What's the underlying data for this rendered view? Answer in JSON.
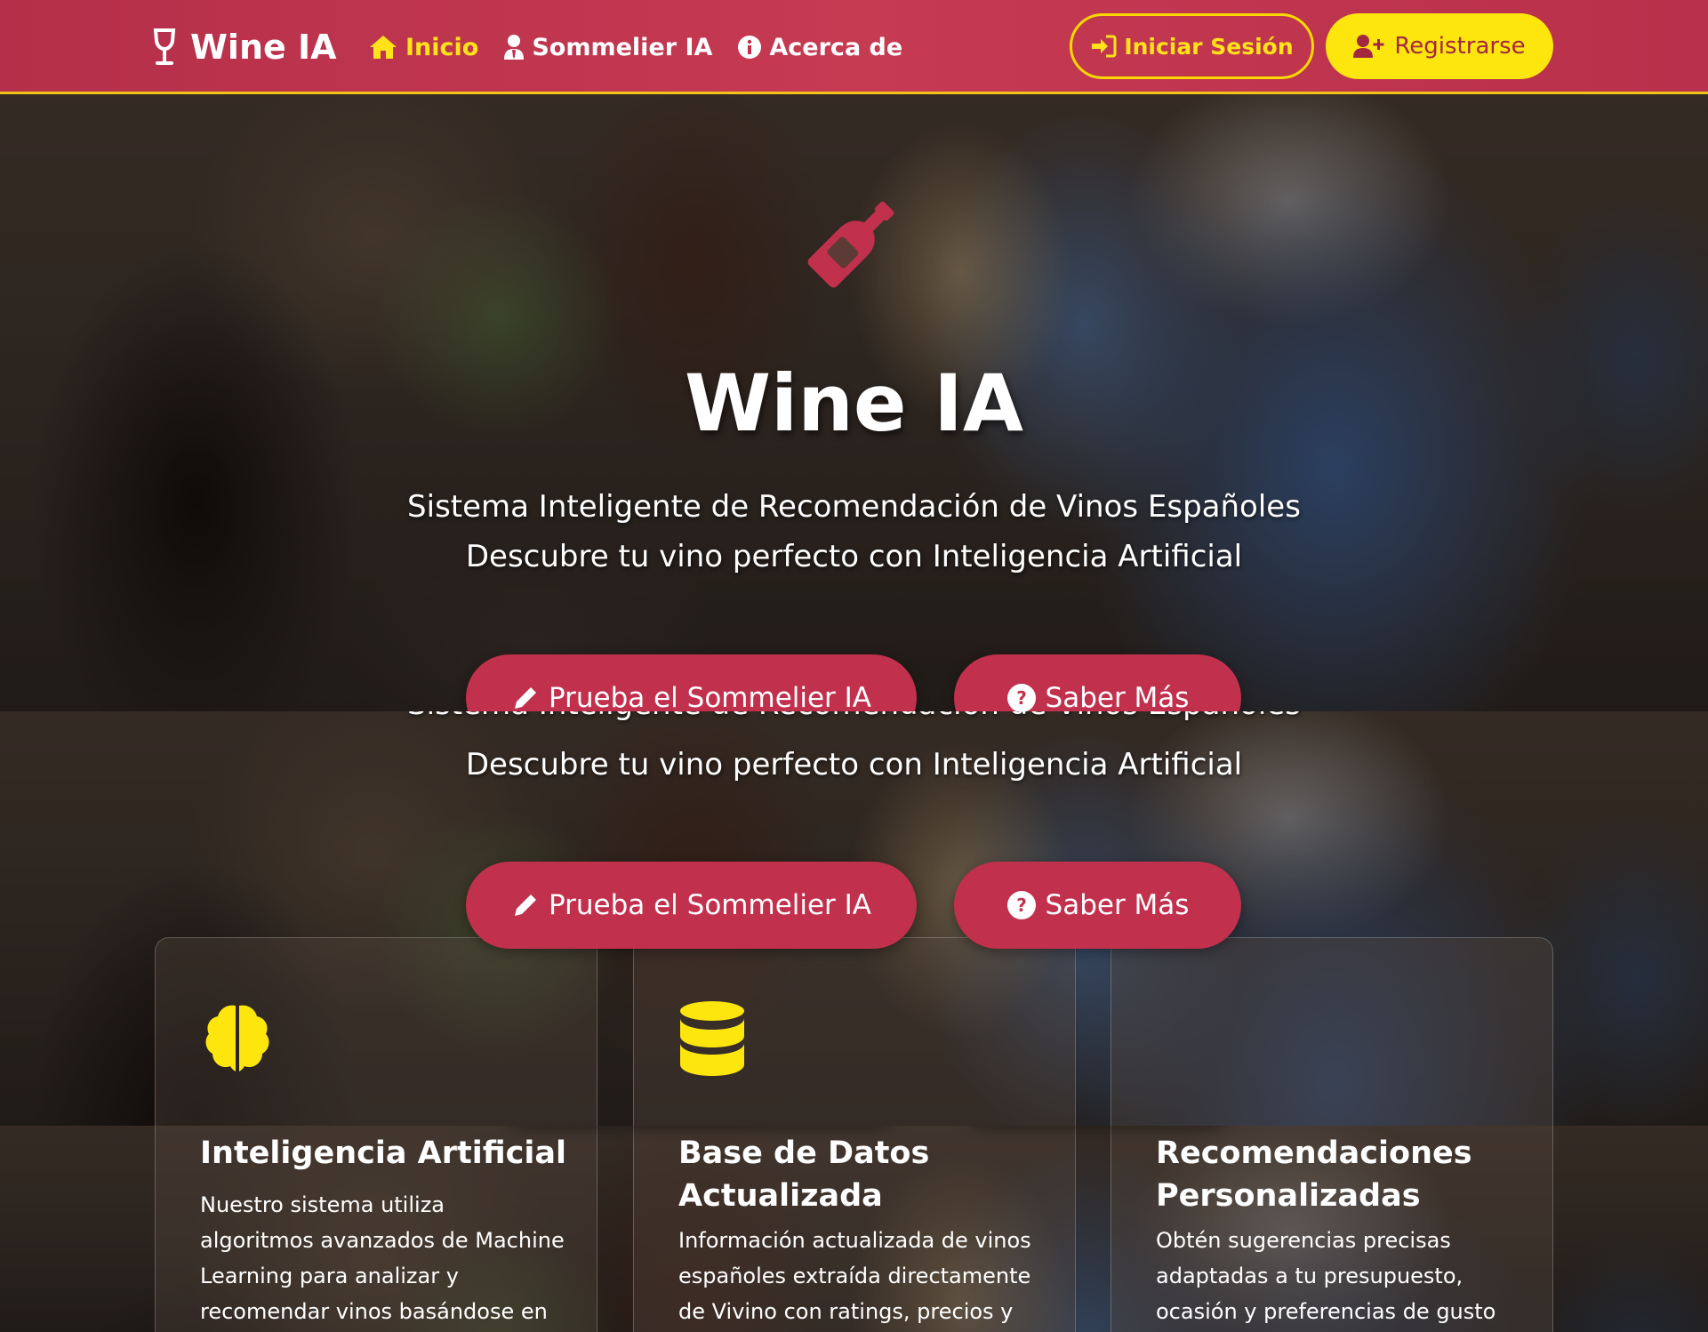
{
  "navbar": {
    "brand": "Wine IA",
    "links": [
      {
        "label": "Inicio",
        "icon": "home-icon",
        "active": true
      },
      {
        "label": "Sommelier IA",
        "icon": "user-tie-icon",
        "active": false
      },
      {
        "label": "Acerca de",
        "icon": "info-circle-icon",
        "active": false
      }
    ],
    "login_label": "Iniciar Sesión",
    "register_label": "Registrarse"
  },
  "hero": {
    "title": "Wine IA",
    "subtitle_line1": "Sistema Inteligente de Recomendación de Vinos Españoles",
    "subtitle_line2": "Descubre tu vino perfecto con Inteligencia Artificial",
    "primary_button": "Prueba el Sommelier IA",
    "secondary_button": "Saber Más"
  },
  "features": [
    {
      "icon": "brain-icon",
      "title": "Inteligencia Artificial",
      "text": "Nuestro sistema utiliza algoritmos avanzados de Machine Learning para analizar y recomendar vinos basándose en tus preferencias."
    },
    {
      "icon": "database-icon",
      "title": "Base de Datos Actualizada",
      "text": "Información actualizada de vinos españoles extraída directamente de Vivino con ratings, precios y"
    },
    {
      "icon": "",
      "title": "Recomendaciones Personalizadas",
      "text": "Obtén sugerencias precisas adaptadas a tu presupuesto, ocasión y preferencias de gusto"
    }
  ],
  "colors": {
    "brand_red": "#c1304c",
    "accent_yellow": "#fde60e"
  }
}
